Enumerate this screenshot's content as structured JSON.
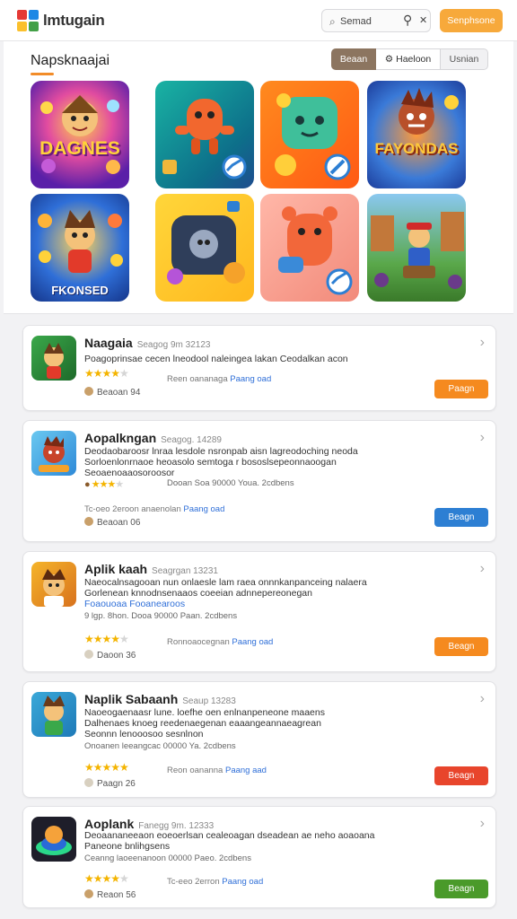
{
  "header": {
    "app_title": "lmtugain",
    "search_value": "Semad",
    "search_placeholder": "Semad",
    "action_label": "Senphsone",
    "logo_colors": [
      "#e53935",
      "#1e88e5",
      "#fbc02d",
      "#43a047"
    ]
  },
  "featured": {
    "title": "Napsknaajai",
    "tabs": [
      "Beaan",
      "Haeloon",
      "Usnian"
    ],
    "active_tab": 0,
    "tile_texts": [
      "DAGNES",
      "FAYONDAS",
      "FKONSED"
    ]
  },
  "apps": [
    {
      "name": "Naagaia",
      "meta": "Seagog 9m 32123",
      "desc": [
        "Poagoprinsae cecen lneodool naleingea lakan Ceodalkan acon"
      ],
      "rating": 4.5,
      "rating_text": "Reen oananaga",
      "rating_link": "Paang oad",
      "players": "Beaoan 94",
      "action": "Paagn",
      "action_color": "#f58a1f"
    },
    {
      "name": "Aopalkngan",
      "meta": "Seagog. 14289",
      "desc": [
        "Deodaobaroosr lnraa lesdole nsronpab aisn lagreodoching neoda",
        "Sorloenlonrnaoe heoasolo semtoga r bososlsepeonnaoogan",
        "Seoaenoaaosoroosor"
      ],
      "sub": "Dooan Soa 90000 Youa. 2cdbens",
      "rating": 4,
      "rating_text": "Tc-oeo 2eroon anaenolan",
      "rating_link": "Paang oad",
      "players": "Beaoan 06",
      "action": "Beagn",
      "action_color": "#2d7fd3"
    },
    {
      "name": "Aplik kaah",
      "meta": "Seagrgan 13231",
      "desc": [
        "Naeocalnsagooan nun onlaesle lam raea onnnkanpanceing nalaera",
        "Gorlenean knnodnsenaaos coeeian adnnepereonegan",
        "Foaouoaa Fooanearoos"
      ],
      "desc_link_line": 2,
      "sub": "9 lgp. 8hon. Dooa 90000 Paan. 2cdbens",
      "rating": 4.5,
      "rating_text": "Ronnoaocegnan",
      "rating_link": "Paang oad",
      "players": "Daoon 36",
      "action": "Beagn",
      "action_color": "#f58a1f"
    },
    {
      "name": "Naplik Sabaanh",
      "meta": "Seaup 13283",
      "desc": [
        "Naoeogaenaasr lune. loefhe oen enlnanpeneone maaens",
        "Dalhenaes knoeg reedenaegenan eaaangeannaeagrean",
        "Seonnn lenooosoo sesnlnon"
      ],
      "sub": "Onoanen leeangcac 00000 Ya. 2cdbens",
      "rating": 5,
      "rating_text": "Reon oananna",
      "rating_link": "Paang aad",
      "players": "Paagn 26",
      "action": "Beagn",
      "action_color": "#e8452c"
    },
    {
      "name": "Aoplank",
      "meta": "Fanegg 9m. 12333",
      "desc": [
        "Deoaananeeaon eoeoerlsan cealeoagan dseadean ae neho aoaoana",
        "Paneone bnlihgsens"
      ],
      "sub": "Ceanng laoeenanoon 00000 Paeo. 2cdbens",
      "rating": 4,
      "rating_text": "Tc-eeo 2erron",
      "rating_link": "Paang oad",
      "players": "Reaon 56",
      "action": "Beagn",
      "action_color": "#4a9a2a"
    }
  ]
}
